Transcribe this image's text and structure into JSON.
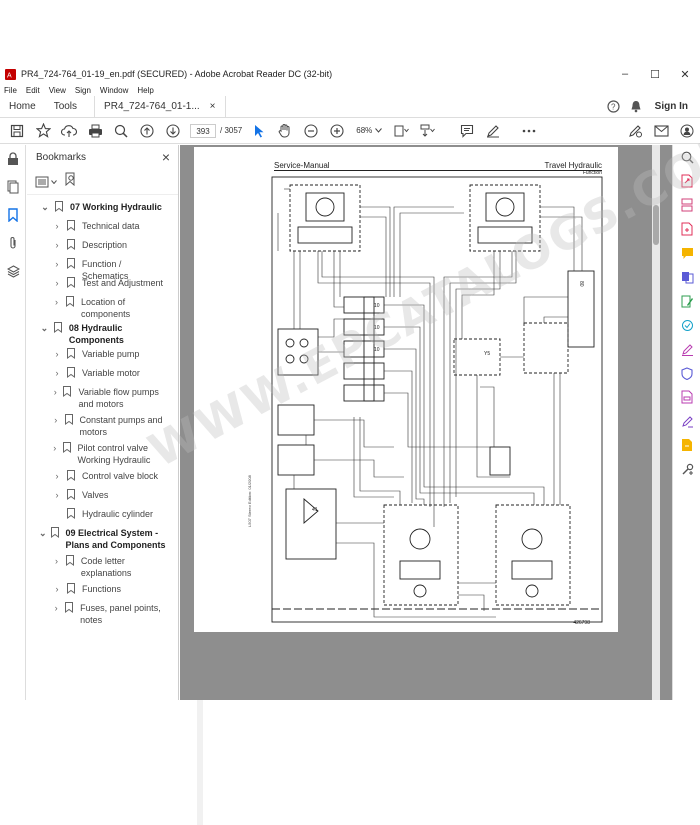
{
  "window": {
    "title": "PR4_724-764_01-19_en.pdf (SECURED) - Adobe Acrobat Reader DC (32-bit)",
    "controls": [
      "–",
      "☐",
      "✕"
    ]
  },
  "menu": [
    "File",
    "Edit",
    "View",
    "Sign",
    "Window",
    "Help"
  ],
  "tabs": {
    "home": "Home",
    "tools": "Tools",
    "doc": "PR4_724-764_01-1...",
    "doc_close": "×",
    "sign_in": "Sign In"
  },
  "toolbar": {
    "page_current": "393",
    "page_total": "/ 3057",
    "zoom": "68%"
  },
  "bookmarks": {
    "title": "Bookmarks",
    "close": "×",
    "items": [
      {
        "label": "07 Working Hydraulic",
        "level": 0,
        "expanded": true
      },
      {
        "label": "Technical data",
        "level": 1
      },
      {
        "label": "Description",
        "level": 1
      },
      {
        "label": "Function / Schematics",
        "level": 1
      },
      {
        "label": "Test and Adjustment",
        "level": 1
      },
      {
        "label": "Location of components",
        "level": 1
      },
      {
        "label": "08 Hydraulic Components",
        "level": 0,
        "expanded": true
      },
      {
        "label": "Variable pump",
        "level": 1
      },
      {
        "label": "Variable motor",
        "level": 1
      },
      {
        "label": "Variable flow pumps and motors",
        "level": 1
      },
      {
        "label": "Constant pumps and motors",
        "level": 1
      },
      {
        "label": "Pilot control valve Working Hydraulic",
        "level": 1
      },
      {
        "label": "Control valve block",
        "level": 1
      },
      {
        "label": "Valves",
        "level": 1
      },
      {
        "label": "Hydraulic cylinder",
        "level": 1,
        "no_chevron": true
      },
      {
        "label": "09 Electrical System - Plans and Components",
        "level": 0,
        "expanded": true
      },
      {
        "label": "Code letter explanations",
        "level": 1
      },
      {
        "label": "Functions",
        "level": 1
      },
      {
        "label": "Fuses, panel points, notes",
        "level": 1
      }
    ]
  },
  "page": {
    "header_left": "Service-Manual",
    "header_right": "Travel Hydraulic",
    "header_sub": "Function",
    "figure_number": "426798",
    "side_text": "L507 Stereo Edition: 01/2008"
  },
  "watermark": "WWW.EPCATALOGS.COM",
  "colors": {
    "accent_blue": "#1473e6",
    "doc_background": "#8e8e8e"
  }
}
